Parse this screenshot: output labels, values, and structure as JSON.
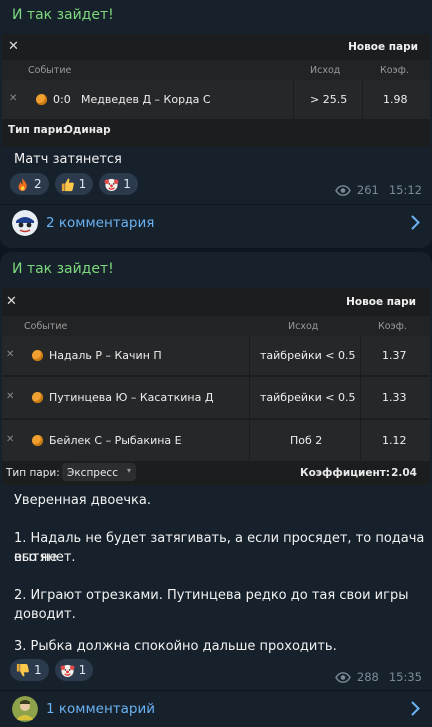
{
  "post1": {
    "title": "И так зайдет!",
    "coupon": {
      "header": "Новое пари",
      "close_icon": "✕",
      "columns": {
        "event": "Событие",
        "outcome": "Исход",
        "odds": "Коэф."
      },
      "rows": [
        {
          "score": "0:0",
          "event": "Медведев Д – Корда С",
          "outcome": "> 25.5",
          "odds": "1.98"
        }
      ],
      "bet_type_label": "Тип пари:",
      "bet_type": "Одинар"
    },
    "message": "Матч затянется",
    "reactions": [
      {
        "icon": "fire-icon",
        "count": "2"
      },
      {
        "icon": "thumbs-up-icon",
        "count": "1"
      },
      {
        "icon": "clown-icon",
        "count": "1"
      }
    ],
    "views": "261",
    "time": "15:12",
    "comments": "2 комментария"
  },
  "post2": {
    "title": "И так зайдет!",
    "coupon": {
      "header": "Новое пари",
      "close_icon": "✕",
      "columns": {
        "event": "Событие",
        "outcome": "Исход",
        "odds": "Коэф."
      },
      "rows": [
        {
          "event": "Надаль Р – Качин П",
          "outcome": "тайбрейки < 0.5",
          "odds": "1.37"
        },
        {
          "event": "Путинцева Ю – Касаткина Д",
          "outcome": "тайбрейки < 0.5",
          "odds": "1.33"
        },
        {
          "event": "Бейлек С – Рыбакина Е",
          "outcome": "Поб 2",
          "odds": "1.12"
        }
      ],
      "bet_type_label": "Тип пари:",
      "bet_type": "Экспресс",
      "total_label": "Коэффициент:",
      "total": "2.04"
    },
    "message": [
      "Уверенная двоечка.",
      "1. Надаль не будет затягивать, а если просядет, то подача его не",
      "вытянет.",
      "2. Играют отрезками. Путинцева редко до тая свои игры",
      "доводит.",
      "3. Рыбка должна спокойно дальше проходить."
    ],
    "reactions": [
      {
        "icon": "thumbs-down-icon",
        "count": "1"
      },
      {
        "icon": "clown-icon",
        "count": "1"
      }
    ],
    "views": "288",
    "time": "15:35",
    "comments": "1 комментарий"
  },
  "colors": {
    "accent": "#6ab2f2",
    "title_green": "#7dd87d",
    "bg": "#0e1621",
    "bubble": "#17212b"
  }
}
